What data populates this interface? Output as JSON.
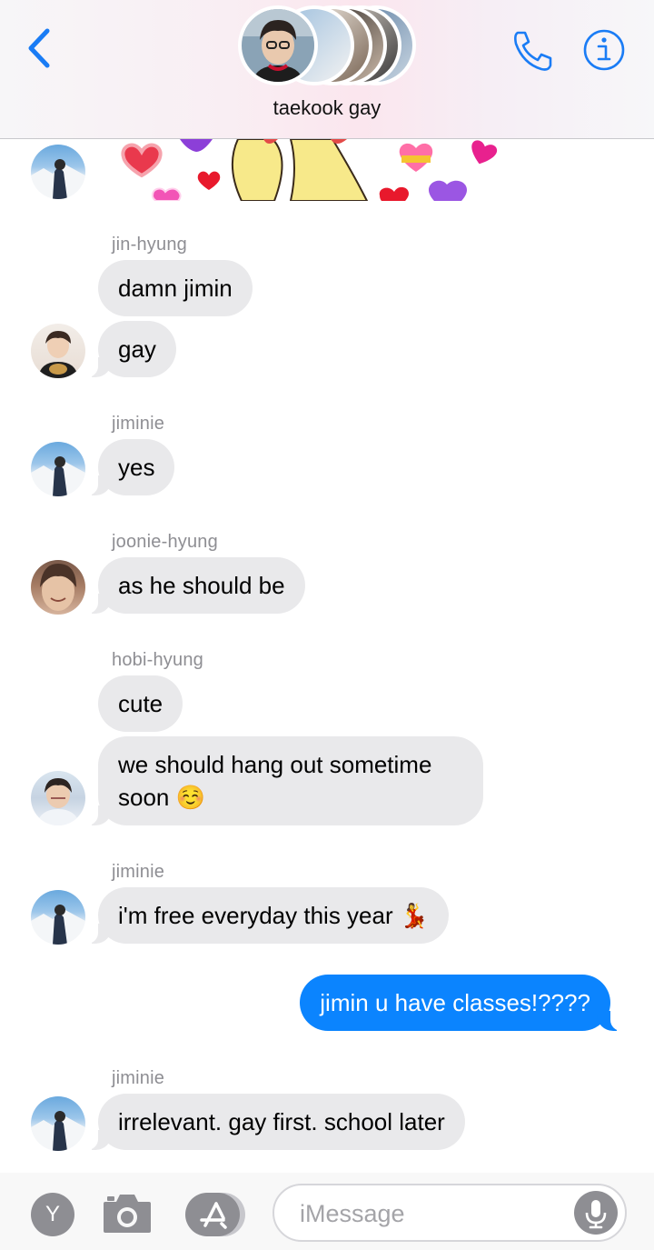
{
  "header": {
    "title": "taekook gay",
    "back_icon": "chevron-left-icon",
    "call_icon": "phone-icon",
    "info_icon": "info-icon",
    "accent_color": "#1a7cf5"
  },
  "messages": [
    {
      "sender": "jin-hyung",
      "bubbles": [
        "damn jimin",
        "gay"
      ]
    },
    {
      "sender": "jiminie",
      "bubbles": [
        "yes"
      ]
    },
    {
      "sender": "joonie-hyung",
      "bubbles": [
        "as he should be"
      ]
    },
    {
      "sender": "hobi-hyung",
      "bubbles": [
        "cute",
        "we should hang out sometime soon ☺️"
      ]
    },
    {
      "sender": "jiminie",
      "bubbles": [
        "i'm free everyday this year 💃"
      ]
    },
    {
      "sender": "me",
      "bubbles": [
        "jimin u have classes!????"
      ]
    },
    {
      "sender": "jiminie",
      "bubbles": [
        "irrelevant. gay first. school later"
      ]
    }
  ],
  "input_bar": {
    "y_label": "Y",
    "placeholder": "iMessage",
    "camera_icon": "camera-icon",
    "apps_icon": "app-store-icon",
    "mic_icon": "microphone-icon"
  },
  "colors": {
    "incoming_bubble": "#e9e9eb",
    "outgoing_bubble": "#0b84fe",
    "sender_label": "#8e8e93"
  }
}
